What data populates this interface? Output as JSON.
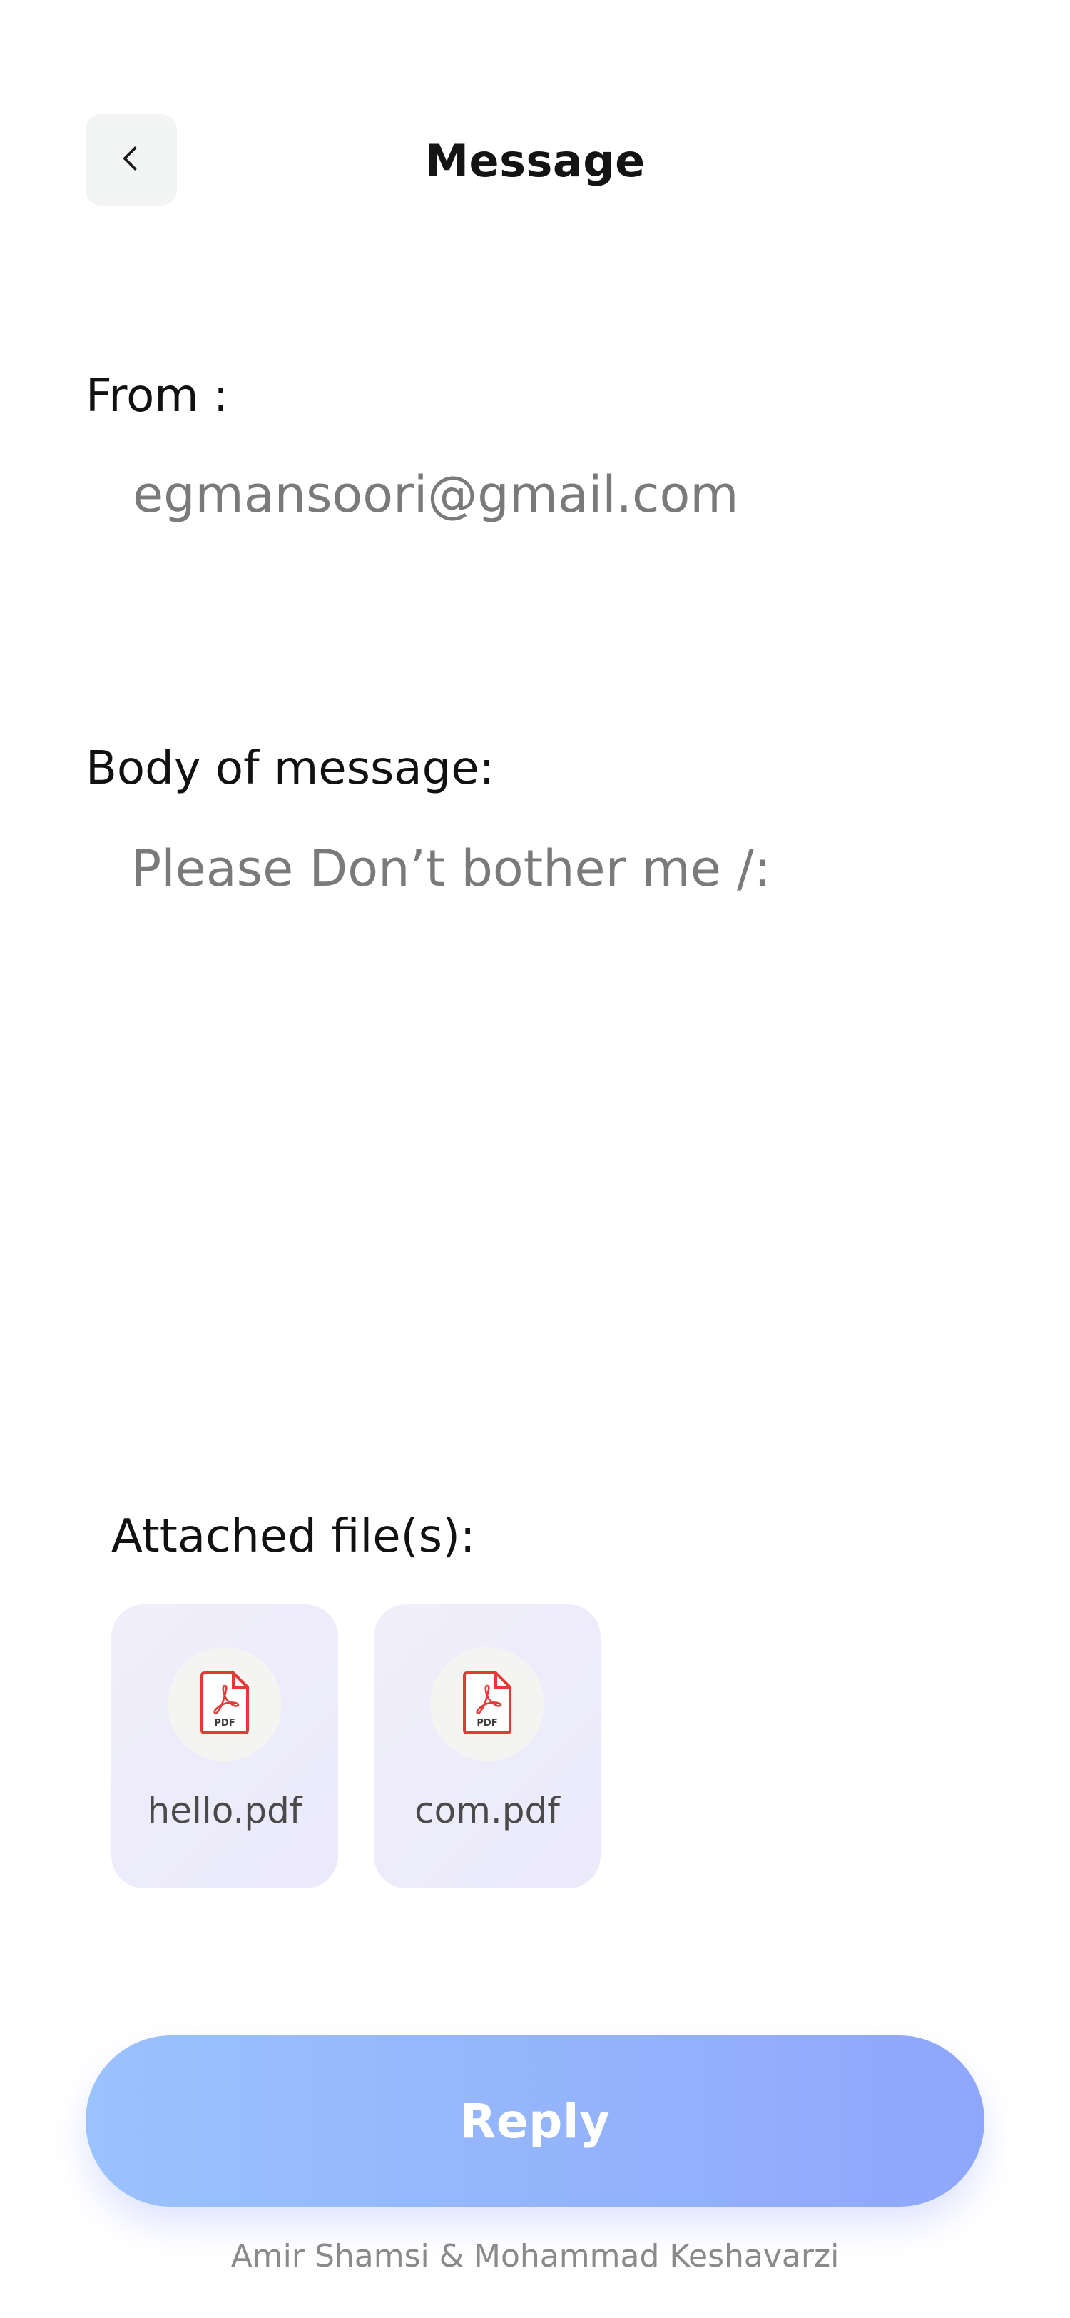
{
  "header": {
    "back_icon": "chevron-left-icon",
    "title": "Message"
  },
  "message": {
    "from_label": "From :",
    "from_value": "egmansoori@gmail.com",
    "body_label": "Body of message:",
    "body_value": "Please  Don’t bother me  /:"
  },
  "attachments": {
    "label": "Attached file(s):",
    "files": [
      {
        "name": "hello.pdf",
        "icon": "pdf-file-icon",
        "badge": "PDF"
      },
      {
        "name": "com.pdf",
        "icon": "pdf-file-icon",
        "badge": "PDF"
      }
    ]
  },
  "actions": {
    "reply_label": "Reply"
  },
  "footer": {
    "credits": "Amir Shamsi & Mohammad Keshavarzi"
  },
  "colors": {
    "reply_gradient_start": "#9ac2fd",
    "reply_gradient_end": "#8fa7fb",
    "pdf_red": "#e53935",
    "card_bg": "#eeecfa"
  }
}
